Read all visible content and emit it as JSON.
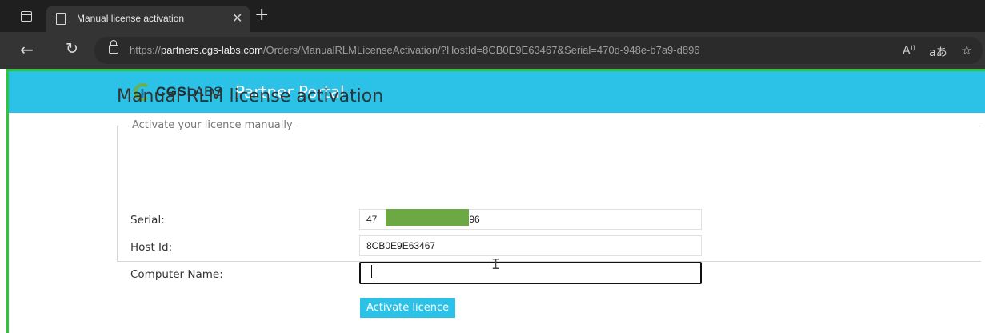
{
  "browser": {
    "tab_title": "Manual license activation",
    "url_scheme": "https://",
    "url_host": "partners.cgs-labs.com",
    "url_path": "/Orders/ManualRLMLicenseActivation/?HostId=8CB0E9E63467&Serial=470d-948e-b7a9-d896",
    "icons": [
      "window-icon",
      "page-icon",
      "close-icon",
      "new-tab-icon",
      "back-icon",
      "reload-icon",
      "lock-icon",
      "read-aloud-icon",
      "translate-icon",
      "favorite-icon"
    ]
  },
  "header": {
    "logo_bold": "CGS",
    "logo_light": "LABS",
    "portal_title": "Partner Portal",
    "color": "#2cc1e6"
  },
  "page": {
    "title": "Manual RLM license activation"
  },
  "form": {
    "legend": "Activate your licence manually",
    "serial_label": "Serial:",
    "serial_value_start": "47",
    "serial_value_end": "96",
    "hostid_label": "Host Id:",
    "hostid_value": "8CB0E9E63467",
    "computer_label": "Computer Name:",
    "computer_value": "",
    "submit_label": "Activate licence"
  }
}
